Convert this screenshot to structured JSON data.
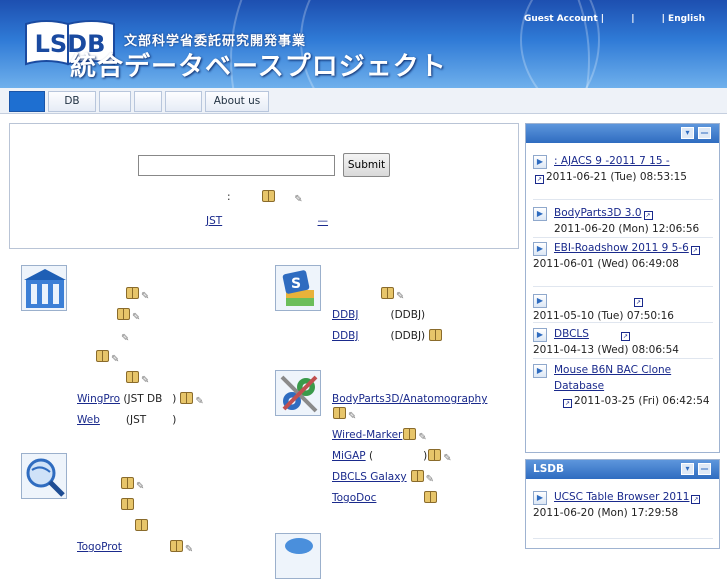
{
  "header": {
    "logo_text": "LSDB",
    "org": "文部科学省委託研究開発事業",
    "title": "統合データベースプロジェクト",
    "guest_account": "Guest Account |",
    "sep1": "|",
    "english": "| English"
  },
  "nav": {
    "tabs": [
      {
        "label": ""
      },
      {
        "label": "DB"
      },
      {
        "label": ""
      },
      {
        "label": ""
      },
      {
        "label": ""
      },
      {
        "label": "About us"
      }
    ]
  },
  "search": {
    "input_value": "",
    "submit_label": "Submit",
    "note": ":",
    "jst_link": "JST"
  },
  "col_left_a": {
    "items": [
      {
        "text": "",
        "suffix": ""
      },
      {
        "text": "",
        "suffix": ""
      },
      {
        "text": "",
        "suffix": ""
      },
      {
        "text": "",
        "suffix": ""
      },
      {
        "text": "",
        "suffix": ""
      },
      {
        "text": "WingPro",
        "suffix": "(JST DB"
      },
      {
        "text": "Web",
        "suffix": "(JST"
      }
    ]
  },
  "col_left_b": {
    "items": [
      {
        "text": "",
        "suffix": ""
      },
      {
        "text": "",
        "suffix": ""
      },
      {
        "text": "",
        "suffix": ""
      },
      {
        "text": "TogoProt",
        "suffix": ""
      }
    ]
  },
  "col_right_a": {
    "items": [
      {
        "text": "",
        "suffix": ""
      },
      {
        "text": "DDBJ",
        "suffix": "(DDBJ)"
      },
      {
        "text": "DDBJ",
        "suffix": "(DDBJ)"
      }
    ]
  },
  "col_right_b": {
    "items": [
      {
        "text": "BodyParts3D/Anatomography",
        "suffix": ""
      },
      {
        "text": "Wired-Marker",
        "suffix": ""
      },
      {
        "text": "MiGAP",
        "suffix": "("
      },
      {
        "text": "DBCLS Galaxy",
        "suffix": ""
      },
      {
        "text": "TogoDoc",
        "suffix": ""
      }
    ]
  },
  "side1": {
    "title": "",
    "news": [
      {
        "link": ": AJACS 9 -2011 7 15 -",
        "meta": "2011-06-21 (Tue) 08:53:15"
      },
      {
        "link": "BodyParts3D 3.0",
        "meta": "2011-06-20 (Mon) 12:06:56"
      },
      {
        "link": "EBI-Roadshow 2011 9 5-6",
        "meta": "2011-06-01 (Wed) 06:49:08"
      },
      {
        "link": "",
        "meta": "2011-05-10 (Tue) 07:50:16"
      },
      {
        "link": "DBCLS",
        "meta": "2011-04-13 (Wed) 08:06:54"
      },
      {
        "link": "Mouse B6N BAC Clone Database",
        "meta": "2011-03-25 (Fri) 06:42:54"
      }
    ]
  },
  "side2": {
    "title": "LSDB",
    "news": [
      {
        "link": "UCSC Table Browser 2011",
        "meta": "2011-06-20 (Mon) 17:29:58"
      }
    ]
  },
  "icons": {
    "head_minimize": "▾",
    "head_close": "—",
    "arrow": "▶",
    "ext": "↗"
  }
}
